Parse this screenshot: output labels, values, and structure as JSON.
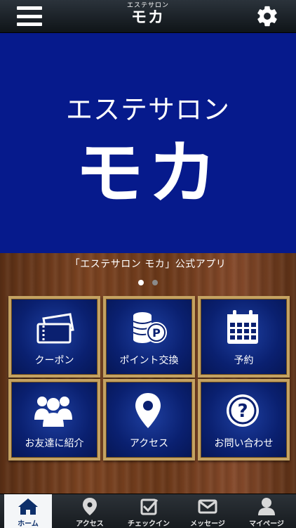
{
  "header": {
    "logo_sub": "エステサロン",
    "logo_main": "モカ",
    "menu_icon": "hamburger-menu-icon",
    "settings_icon": "gear-icon"
  },
  "banner": {
    "subtitle": "エステサロン",
    "title": "モカ",
    "bg_color": "#061a8c"
  },
  "caption": "「エステサロン モカ」公式アプリ",
  "carousel": {
    "count": 2,
    "active_index": 0
  },
  "tiles": [
    {
      "label": "クーポン",
      "icon": "coupon-ticket-icon"
    },
    {
      "label": "ポイント交換",
      "icon": "points-coins-icon"
    },
    {
      "label": "予約",
      "icon": "calendar-icon"
    },
    {
      "label": "お友達に紹介",
      "icon": "group-people-icon"
    },
    {
      "label": "アクセス",
      "icon": "map-pin-icon"
    },
    {
      "label": "お問い合わせ",
      "icon": "question-icon"
    }
  ],
  "tabbar": [
    {
      "label": "ホーム",
      "icon": "home-icon",
      "active": true
    },
    {
      "label": "アクセス",
      "icon": "map-pin-icon",
      "active": false
    },
    {
      "label": "チェックイン",
      "icon": "checkin-icon",
      "active": false
    },
    {
      "label": "メッセージ",
      "icon": "envelope-icon",
      "active": false
    },
    {
      "label": "マイページ",
      "icon": "person-icon",
      "active": false
    }
  ],
  "colors": {
    "tile_border": "#c4a262",
    "tile_bg": "#0a2070",
    "accent": "#061a8c"
  }
}
